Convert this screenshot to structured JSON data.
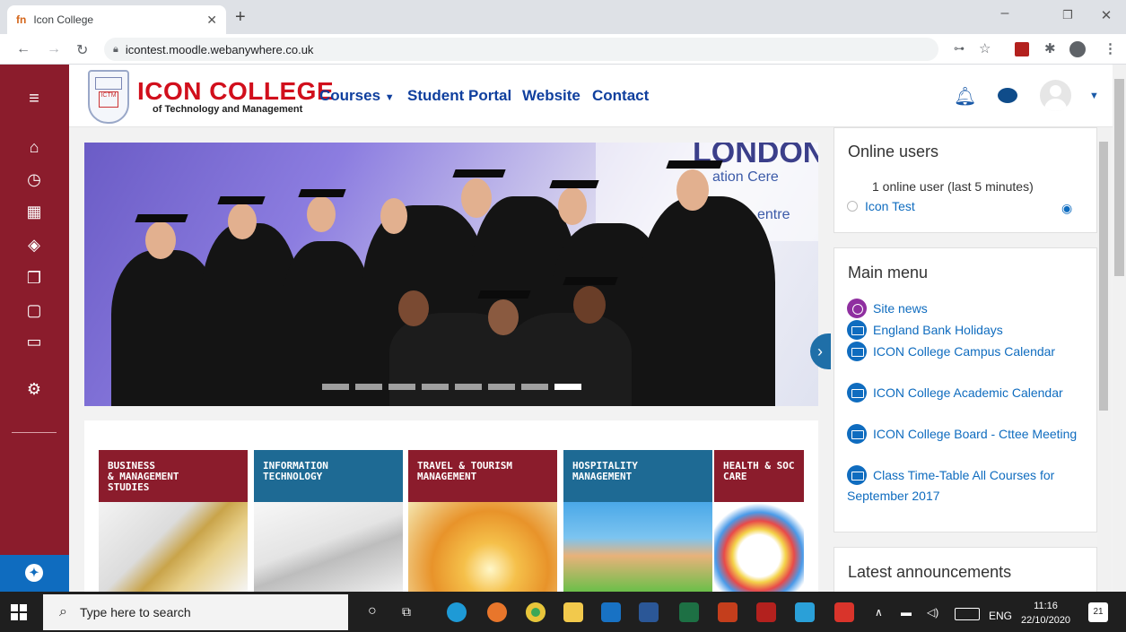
{
  "browser": {
    "tab_title": "Icon College",
    "tab_favicon": "fn",
    "url": "icontest.moodle.webanywhere.co.uk"
  },
  "site": {
    "logo_title": "ICON COLLEGE",
    "logo_subtitle": "of Technology and Management",
    "crest_text": "ICTM",
    "brand_color": "#8b1c2c",
    "link_color": "#0f6cbf"
  },
  "nav": {
    "courses": "Courses",
    "student_portal": "Student Portal",
    "website": "Website",
    "contact": "Contact"
  },
  "slider": {
    "banner_line1": "LONDON",
    "banner_line2": "ation Cere",
    "banner_line3": "entre",
    "slide_count": 8,
    "active_slide": 8
  },
  "course_tiles": [
    {
      "label": "BUSINESS\n& MANAGEMENT\nSTUDIES",
      "color": "#8b1c2c"
    },
    {
      "label": "INFORMATION\nTECHNOLOGY",
      "color": "#1e6a94"
    },
    {
      "label": "TRAVEL & TOURISM\nMANAGEMENT",
      "color": "#8b1c2c"
    },
    {
      "label": "HOSPITALITY\nMANAGEMENT",
      "color": "#1e6a94"
    },
    {
      "label": "HEALTH & SOC\nCARE",
      "color": "#8b1c2c"
    }
  ],
  "online_users": {
    "title": "Online users",
    "count_text": "1 online user (last 5 minutes)",
    "user": "Icon Test"
  },
  "main_menu": {
    "title": "Main menu",
    "items": [
      "Site news",
      "England Bank Holidays",
      "ICON College Campus Calendar",
      "ICON College Academic Calendar",
      "ICON College Board - Cttee Meeting",
      "Class Time-Table All Courses for September 2017"
    ]
  },
  "announcements": {
    "title": "Latest announcements"
  },
  "taskbar": {
    "search_placeholder": "Type here to search",
    "lang": "ENG",
    "time": "11:16",
    "date": "22/10/2020",
    "notif_count": "21"
  }
}
